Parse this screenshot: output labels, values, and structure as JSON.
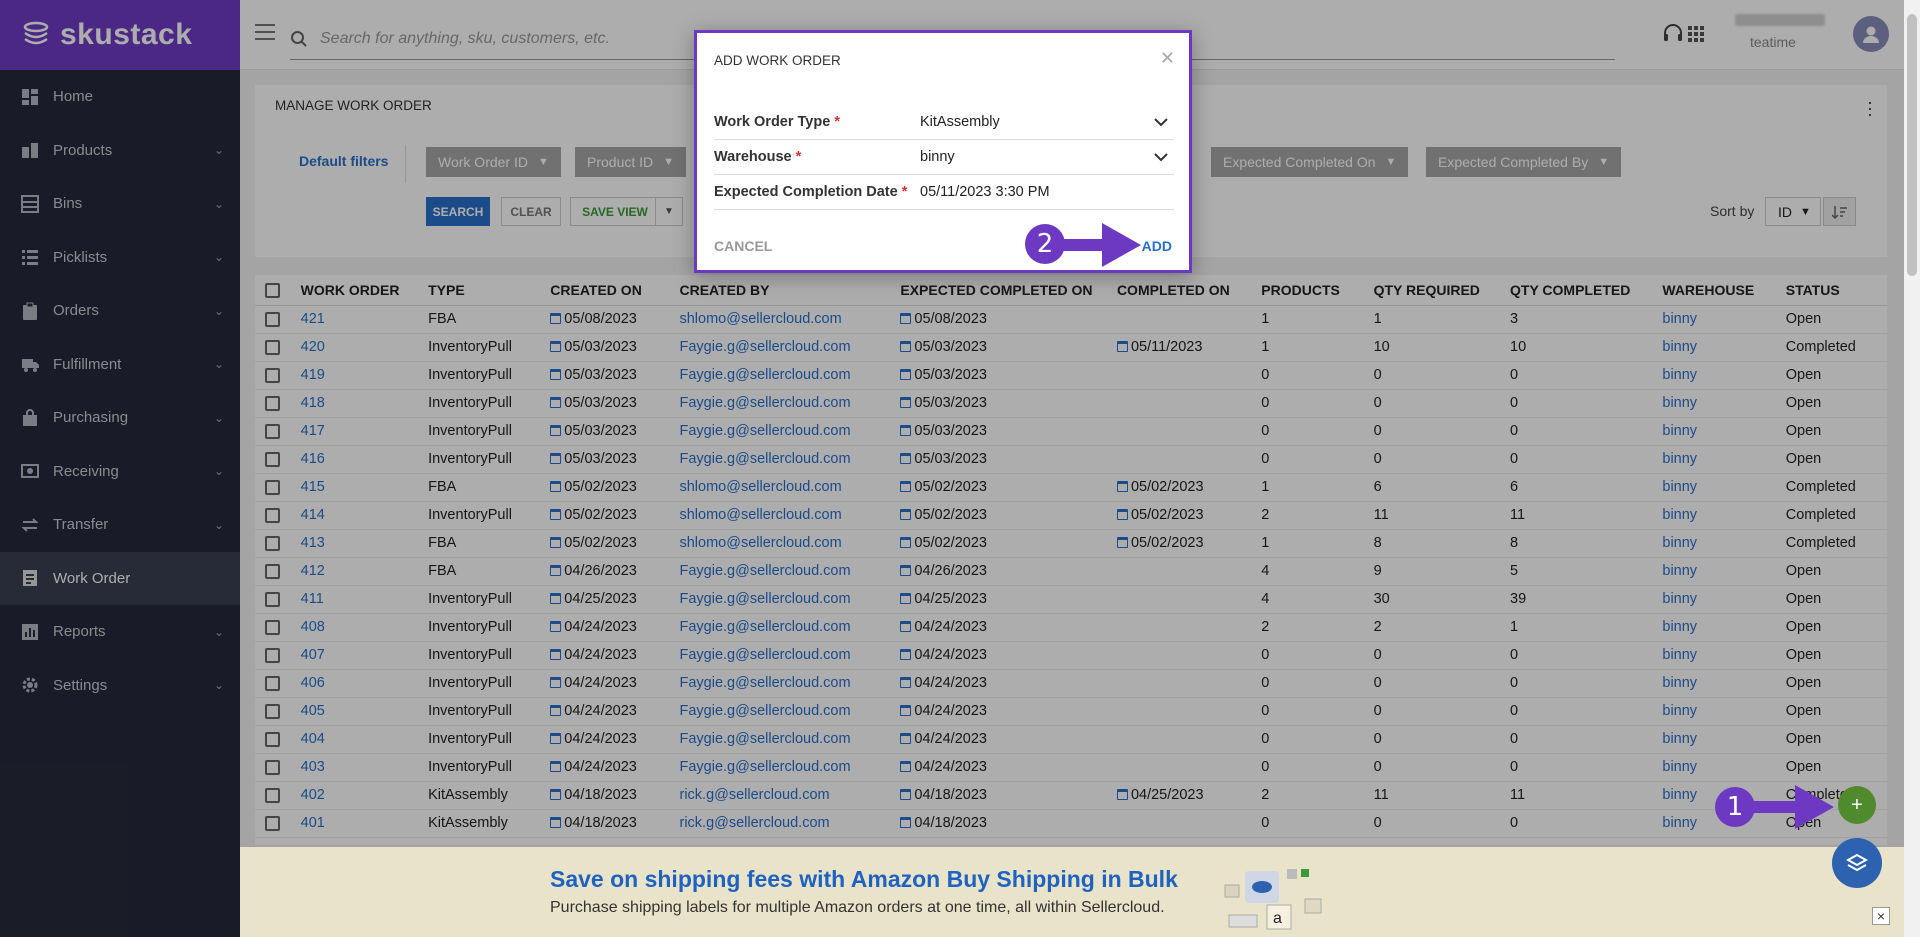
{
  "brand": {
    "name": "skustack"
  },
  "sidebar": {
    "items": [
      {
        "label": "Home",
        "icon": "dashboard-icon",
        "has_chevron": false
      },
      {
        "label": "Products",
        "icon": "products-icon",
        "has_chevron": true
      },
      {
        "label": "Bins",
        "icon": "bins-icon",
        "has_chevron": true
      },
      {
        "label": "Picklists",
        "icon": "list-icon",
        "has_chevron": true
      },
      {
        "label": "Orders",
        "icon": "clipboard-icon",
        "has_chevron": true
      },
      {
        "label": "Fulfillment",
        "icon": "truck-icon",
        "has_chevron": true
      },
      {
        "label": "Purchasing",
        "icon": "bag-icon",
        "has_chevron": true
      },
      {
        "label": "Receiving",
        "icon": "money-icon",
        "has_chevron": true
      },
      {
        "label": "Transfer",
        "icon": "transfer-icon",
        "has_chevron": true
      },
      {
        "label": "Work Order",
        "icon": "document-icon",
        "has_chevron": false,
        "active": true
      },
      {
        "label": "Reports",
        "icon": "bar-chart-icon",
        "has_chevron": true
      },
      {
        "label": "Settings",
        "icon": "gear-icon",
        "has_chevron": true
      }
    ]
  },
  "topbar": {
    "search_placeholder": "Search for anything, sku, customers, etc.",
    "user_subtitle": "teatime"
  },
  "page": {
    "title": "MANAGE WORK ORDER",
    "default_filters": "Default filters",
    "filters": [
      "Work Order ID",
      "Product ID",
      "Expected Completed On",
      "Expected Completed By"
    ],
    "search_btn": "SEARCH",
    "clear_btn": "CLEAR",
    "save_view_btn": "SAVE VIEW",
    "sort_by_label": "Sort by",
    "sort_by_value": "ID"
  },
  "table": {
    "columns": [
      "WORK ORDER",
      "TYPE",
      "CREATED ON",
      "CREATED BY",
      "EXPECTED COMPLETED ON",
      "COMPLETED ON",
      "PRODUCTS",
      "QTY REQUIRED",
      "QTY COMPLETED",
      "WAREHOUSE",
      "STATUS"
    ],
    "rows": [
      [
        "421",
        "FBA",
        "05/08/2023",
        "shlomo@sellercloud.com",
        "05/08/2023",
        "",
        "1",
        "1",
        "3",
        "binny",
        "Open"
      ],
      [
        "420",
        "InventoryPull",
        "05/03/2023",
        "Faygie.g@sellercloud.com",
        "05/03/2023",
        "05/11/2023",
        "1",
        "10",
        "10",
        "binny",
        "Completed"
      ],
      [
        "419",
        "InventoryPull",
        "05/03/2023",
        "Faygie.g@sellercloud.com",
        "05/03/2023",
        "",
        "0",
        "0",
        "0",
        "binny",
        "Open"
      ],
      [
        "418",
        "InventoryPull",
        "05/03/2023",
        "Faygie.g@sellercloud.com",
        "05/03/2023",
        "",
        "0",
        "0",
        "0",
        "binny",
        "Open"
      ],
      [
        "417",
        "InventoryPull",
        "05/03/2023",
        "Faygie.g@sellercloud.com",
        "05/03/2023",
        "",
        "0",
        "0",
        "0",
        "binny",
        "Open"
      ],
      [
        "416",
        "InventoryPull",
        "05/03/2023",
        "Faygie.g@sellercloud.com",
        "05/03/2023",
        "",
        "0",
        "0",
        "0",
        "binny",
        "Open"
      ],
      [
        "415",
        "FBA",
        "05/02/2023",
        "shlomo@sellercloud.com",
        "05/02/2023",
        "05/02/2023",
        "1",
        "6",
        "6",
        "binny",
        "Completed"
      ],
      [
        "414",
        "InventoryPull",
        "05/02/2023",
        "shlomo@sellercloud.com",
        "05/02/2023",
        "05/02/2023",
        "2",
        "11",
        "11",
        "binny",
        "Completed"
      ],
      [
        "413",
        "FBA",
        "05/02/2023",
        "shlomo@sellercloud.com",
        "05/02/2023",
        "05/02/2023",
        "1",
        "8",
        "8",
        "binny",
        "Completed"
      ],
      [
        "412",
        "FBA",
        "04/26/2023",
        "Faygie.g@sellercloud.com",
        "04/26/2023",
        "",
        "4",
        "9",
        "5",
        "binny",
        "Open"
      ],
      [
        "411",
        "InventoryPull",
        "04/25/2023",
        "Faygie.g@sellercloud.com",
        "04/25/2023",
        "",
        "4",
        "30",
        "39",
        "binny",
        "Open"
      ],
      [
        "408",
        "InventoryPull",
        "04/24/2023",
        "Faygie.g@sellercloud.com",
        "04/24/2023",
        "",
        "2",
        "2",
        "1",
        "binny",
        "Open"
      ],
      [
        "407",
        "InventoryPull",
        "04/24/2023",
        "Faygie.g@sellercloud.com",
        "04/24/2023",
        "",
        "0",
        "0",
        "0",
        "binny",
        "Open"
      ],
      [
        "406",
        "InventoryPull",
        "04/24/2023",
        "Faygie.g@sellercloud.com",
        "04/24/2023",
        "",
        "0",
        "0",
        "0",
        "binny",
        "Open"
      ],
      [
        "405",
        "InventoryPull",
        "04/24/2023",
        "Faygie.g@sellercloud.com",
        "04/24/2023",
        "",
        "0",
        "0",
        "0",
        "binny",
        "Open"
      ],
      [
        "404",
        "InventoryPull",
        "04/24/2023",
        "Faygie.g@sellercloud.com",
        "04/24/2023",
        "",
        "0",
        "0",
        "0",
        "binny",
        "Open"
      ],
      [
        "403",
        "InventoryPull",
        "04/24/2023",
        "Faygie.g@sellercloud.com",
        "04/24/2023",
        "",
        "0",
        "0",
        "0",
        "binny",
        "Open"
      ],
      [
        "402",
        "KitAssembly",
        "04/18/2023",
        "rick.g@sellercloud.com",
        "04/18/2023",
        "04/25/2023",
        "2",
        "11",
        "11",
        "binny",
        "Completed"
      ],
      [
        "401",
        "KitAssembly",
        "04/18/2023",
        "rick.g@sellercloud.com",
        "04/18/2023",
        "",
        "0",
        "0",
        "0",
        "binny",
        "Open"
      ]
    ]
  },
  "modal": {
    "title": "ADD WORK ORDER",
    "type_label": "Work Order Type",
    "type_value": "KitAssembly",
    "warehouse_label": "Warehouse",
    "warehouse_value": "binny",
    "date_label": "Expected Completion Date",
    "date_value": "05/11/2023 3:30 PM",
    "required_mark": "*",
    "cancel": "CANCEL",
    "add": "ADD"
  },
  "annotations": {
    "step1": "1",
    "step2": "2",
    "color": "#6d39c2"
  },
  "banner": {
    "title": "Save on shipping fees with Amazon Buy Shipping in Bulk",
    "subtitle": "Purchase shipping labels for multiple Amazon orders at one time, all within Sellercloud.",
    "close": "×"
  },
  "fab": {
    "add": "+"
  },
  "colors": {
    "brand": "#6f3cc4",
    "sidebar": "#262a3b",
    "link": "#2a6fca",
    "fab_add": "#4f8a2c",
    "fab_layers": "#2c62b0"
  }
}
